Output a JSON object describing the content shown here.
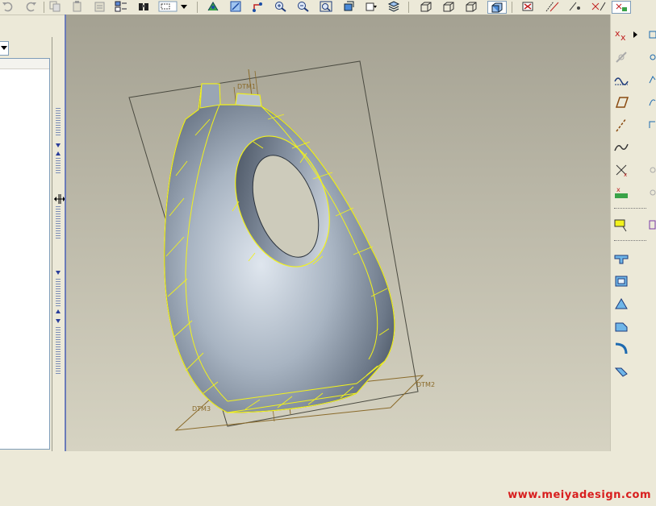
{
  "toolbar": {
    "icons": [
      "undo-icon",
      "redo-icon",
      "copy-icon",
      "paste-icon",
      "paste-special-icon",
      "regenerate-icon",
      "model-tree-icon",
      "find-icon",
      "select-box-icon",
      "dropdown-arrow-icon",
      "spin-center-icon",
      "repaint-icon",
      "orient-icon",
      "zoom-in-icon",
      "zoom-out-icon",
      "refit-icon",
      "view-manager-icon",
      "saved-views-icon",
      "layers-icon",
      "wireframe-icon",
      "hidden-line-icon",
      "no-hidden-icon",
      "shading-icon",
      "datum-planes-toggle-icon",
      "datum-axes-toggle-icon",
      "datum-points-toggle-icon",
      "coordinate-systems-toggle-icon"
    ]
  },
  "graphics": {
    "datum_labels": {
      "top": "DTM1",
      "right": "DTM2",
      "left": "DTM3"
    },
    "model": "bottle-with-handle"
  },
  "right_toolbar": {
    "icons": [
      "datum-point-icon",
      "datum-axis-icon",
      "datum-curve-icon",
      "datum-plane-icon",
      "datum-axis-line-icon",
      "sketch-curve-icon",
      "coordinate-system-icon",
      "analysis-icon",
      "note-icon",
      "extrude-icon",
      "shell-icon",
      "draft-icon",
      "chamfer-icon",
      "round-icon",
      "rib-icon"
    ]
  },
  "watermark": "www.meiyadesign.com",
  "colors": {
    "background": "#ece9d8",
    "graphics_top": "#a4a192",
    "graphics_bottom": "#d6d3c2",
    "highlight": "#f2f21c",
    "datum": "#8a6a2a"
  }
}
